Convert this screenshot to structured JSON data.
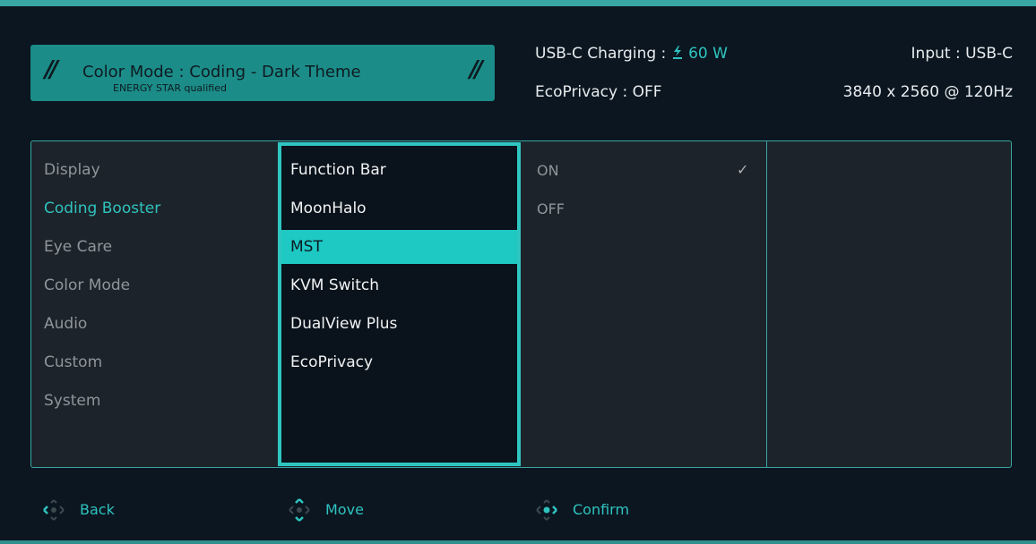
{
  "header": {
    "color_mode_label": "Color Mode : Coding - Dark Theme",
    "energy_star": "ENERGY STAR qualified",
    "usb_c_charging_label": "USB-C Charging : ",
    "charging_watts": "60 W",
    "ecoprivacy_status": "EcoPrivacy : OFF",
    "input": "Input : USB-C",
    "resolution": "3840 x 2560 @ 120Hz"
  },
  "menu": {
    "items": [
      "Display",
      "Coding Booster",
      "Eye Care",
      "Color Mode",
      "Audio",
      "Custom",
      "System"
    ],
    "active": "Coding Booster"
  },
  "submenu": {
    "items": [
      "Function Bar",
      "MoonHalo",
      "MST",
      "KVM Switch",
      "DualView Plus",
      "EcoPrivacy"
    ],
    "selected": "MST"
  },
  "options": {
    "items": [
      "ON",
      "OFF"
    ],
    "checked": "ON"
  },
  "footer": {
    "back": "Back",
    "move": "Move",
    "confirm": "Confirm"
  },
  "colors": {
    "accent": "#2ec6c1",
    "banner": "#1c8c88",
    "background": "#0b1620"
  },
  "icons": {
    "charging": "lightning-plug-icon",
    "back": "joystick-left-icon",
    "move": "joystick-updown-icon",
    "confirm": "joystick-press-icon",
    "check": "checkmark-icon"
  }
}
